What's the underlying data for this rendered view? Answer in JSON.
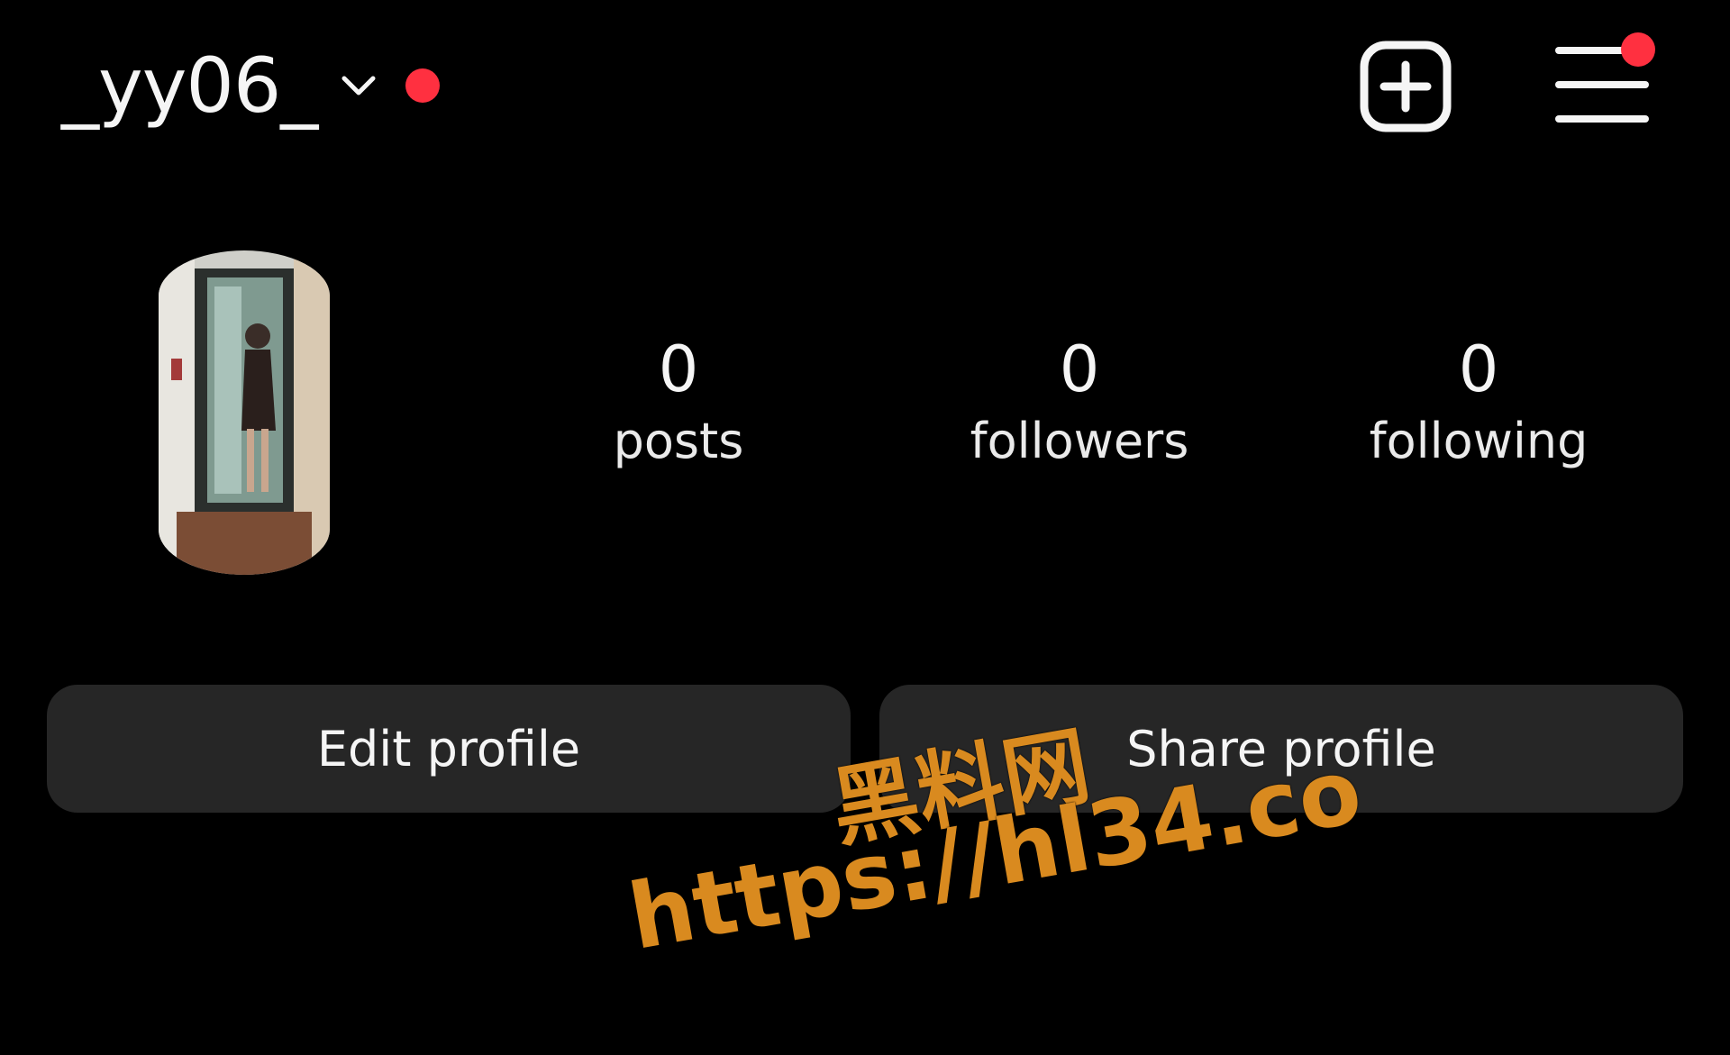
{
  "header": {
    "username": "_yy06_",
    "account_switch_icon": "chevron-down-icon",
    "new_post_icon": "plus-square-icon",
    "menu_icon": "hamburger-menu-icon",
    "notification_color": "#ff3040"
  },
  "profile": {
    "avatar": "profile-photo-mirror-selfie",
    "stats": [
      {
        "value": "0",
        "label": "posts"
      },
      {
        "value": "0",
        "label": "followers"
      },
      {
        "value": "0",
        "label": "following"
      }
    ]
  },
  "actions": {
    "edit_label": "Edit profile",
    "share_label": "Share profile",
    "button_bg": "#262626"
  },
  "watermark": {
    "line1": "黑料网",
    "line2": "https://hl34.co",
    "color": "#d98a1f"
  }
}
